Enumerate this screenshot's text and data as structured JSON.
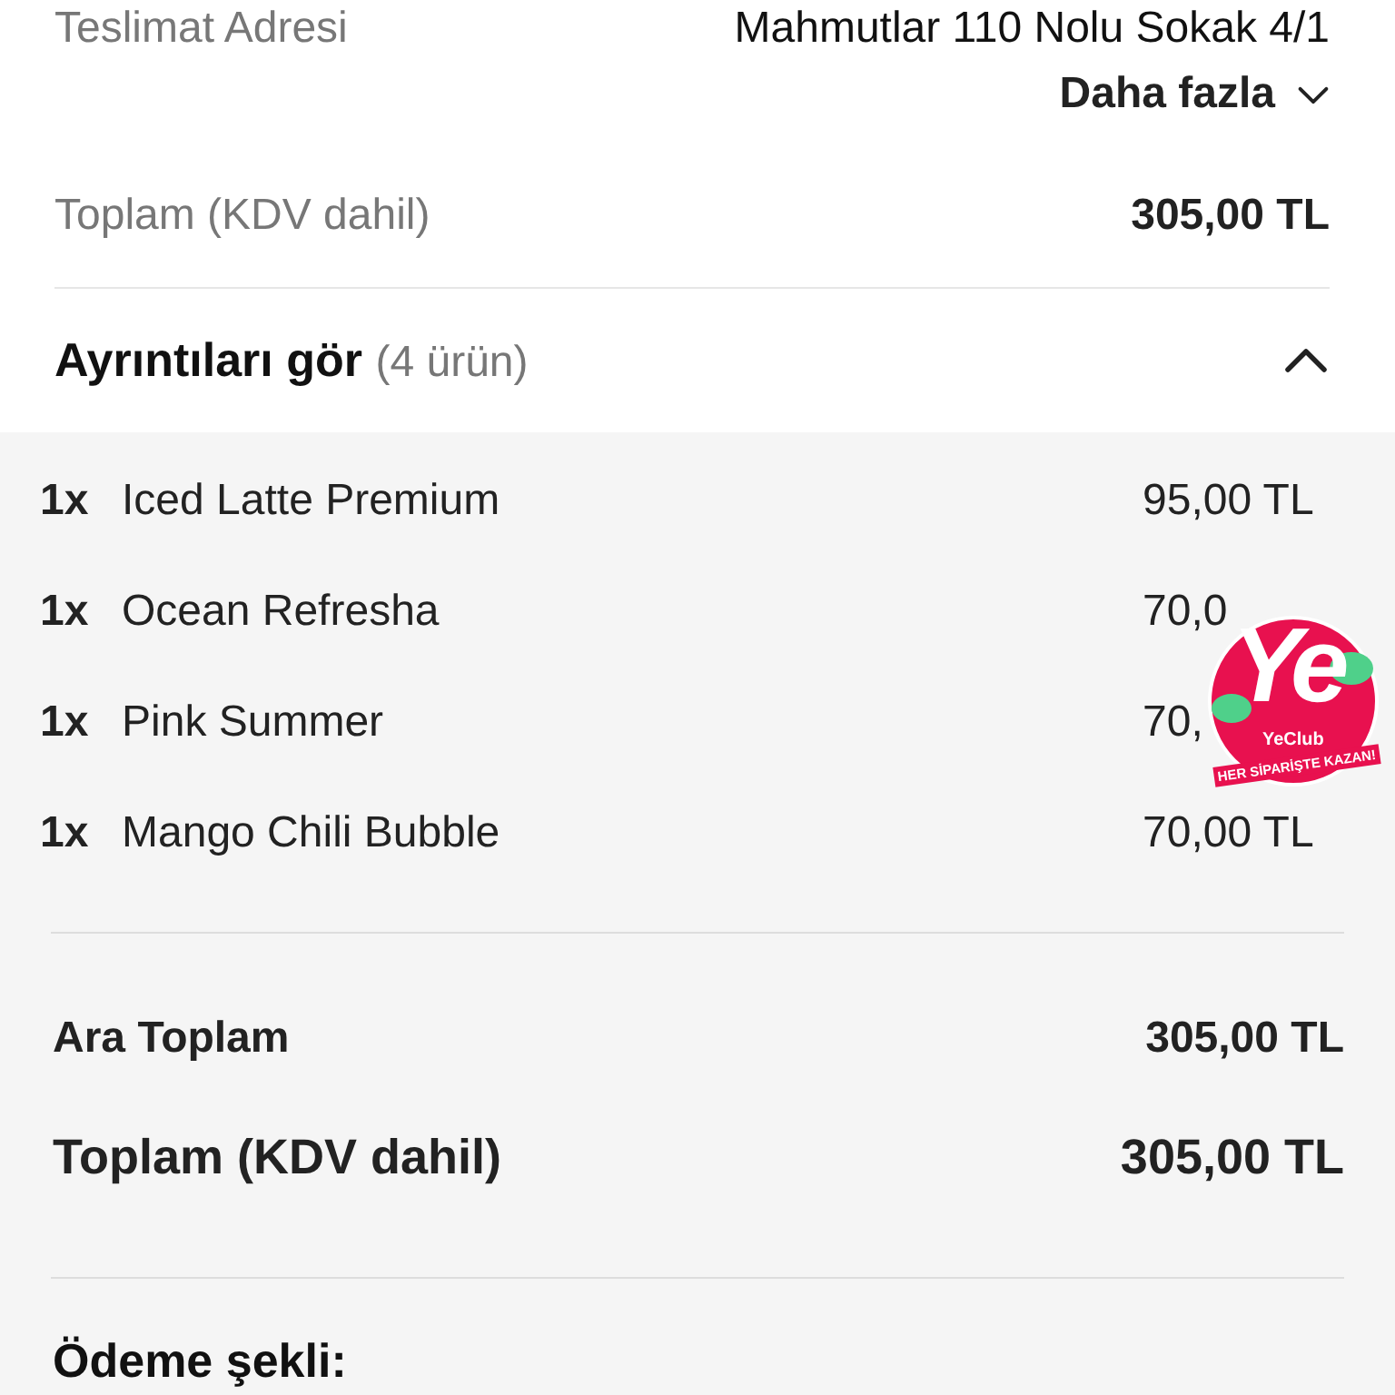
{
  "delivery": {
    "label": "Teslimat Adresi",
    "address": "Mahmutlar 110 Nolu Sokak 4/1",
    "more": "Daha fazla",
    "expanded": false
  },
  "total_top": {
    "label": "Toplam (KDV dahil)",
    "value": "305,00 TL"
  },
  "details": {
    "title": "Ayrıntıları gör",
    "count": "(4 ürün)",
    "expanded": true
  },
  "items": [
    {
      "qty": "1x",
      "name": "Iced Latte Premium",
      "price": "95,00 TL"
    },
    {
      "qty": "1x",
      "name": "Ocean Refresha",
      "price": "70,0"
    },
    {
      "qty": "1x",
      "name": "Pink Summer",
      "price": "70,"
    },
    {
      "qty": "1x",
      "name": "Mango Chili Bubble",
      "price": "70,00 TL"
    }
  ],
  "summary": [
    {
      "label": "Ara Toplam",
      "value": "305,00 TL"
    },
    {
      "label": "Toplam (KDV dahil)",
      "value": "305,00 TL"
    }
  ],
  "payment": {
    "title": "Ödeme şekli:"
  },
  "badge": {
    "logo": "Ye",
    "name": "YeClub",
    "slogan": "HER SİPARİŞTE KAZAN!"
  }
}
